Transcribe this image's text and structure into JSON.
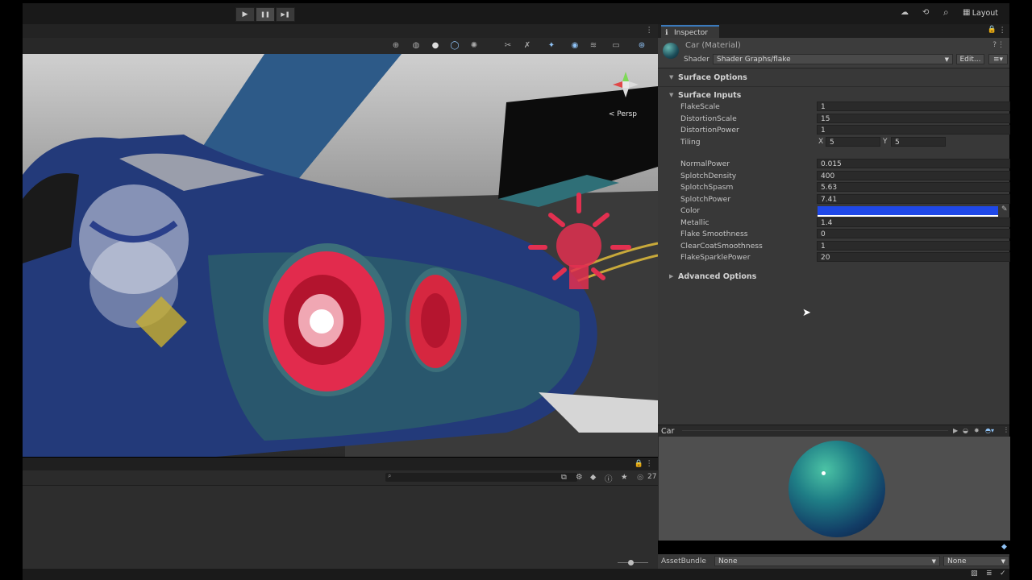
{
  "toolbar": {
    "play_icon": "▶",
    "pause_icon": "❚❚",
    "step_icon": "▶❚",
    "cloud_icon": "☁",
    "history_icon": "⟲",
    "search_icon": "⌕",
    "layout_label": "Layout"
  },
  "scene": {
    "persp_label": "< Persp"
  },
  "console": {
    "count": "27"
  },
  "inspector": {
    "tab_label": "Inspector",
    "material_title": "Car (Material)",
    "shader_label": "Shader",
    "shader_value": "Shader Graphs/flake",
    "edit_button": "Edit...",
    "sections": {
      "surface_options": "Surface Options",
      "surface_inputs": "Surface Inputs",
      "advanced_options": "Advanced Options"
    },
    "props": {
      "flake_scale": {
        "label": "FlakeScale",
        "value": "1"
      },
      "distortion_scale": {
        "label": "DistortionScale",
        "value": "15"
      },
      "distortion_power": {
        "label": "DistortionPower",
        "value": "1"
      },
      "tiling": {
        "label": "Tiling",
        "x_label": "X",
        "x_value": "5",
        "y_label": "Y",
        "y_value": "5"
      },
      "normal_power": {
        "label": "NormalPower",
        "value": "0.015"
      },
      "splotch_density": {
        "label": "SplotchDensity",
        "value": "400"
      },
      "splotch_spasm": {
        "label": "SplotchSpasm",
        "value": "5.63"
      },
      "splotch_power": {
        "label": "SplotchPower",
        "value": "7.41"
      },
      "color": {
        "label": "Color",
        "hex": "#1f48e8"
      },
      "metallic": {
        "label": "Metallic",
        "value": "1.4"
      },
      "flake_smoothness": {
        "label": "Flake Smoothness",
        "value": "0"
      },
      "clearcoat_smoothness": {
        "label": "ClearCoatSmoothness",
        "value": "1"
      },
      "flake_sparkle_power": {
        "label": "FlakeSparklePower",
        "value": "20"
      }
    }
  },
  "preview": {
    "title": "Car"
  },
  "asset_bundle": {
    "label": "AssetBundle",
    "value1": "None",
    "value2": "None"
  }
}
